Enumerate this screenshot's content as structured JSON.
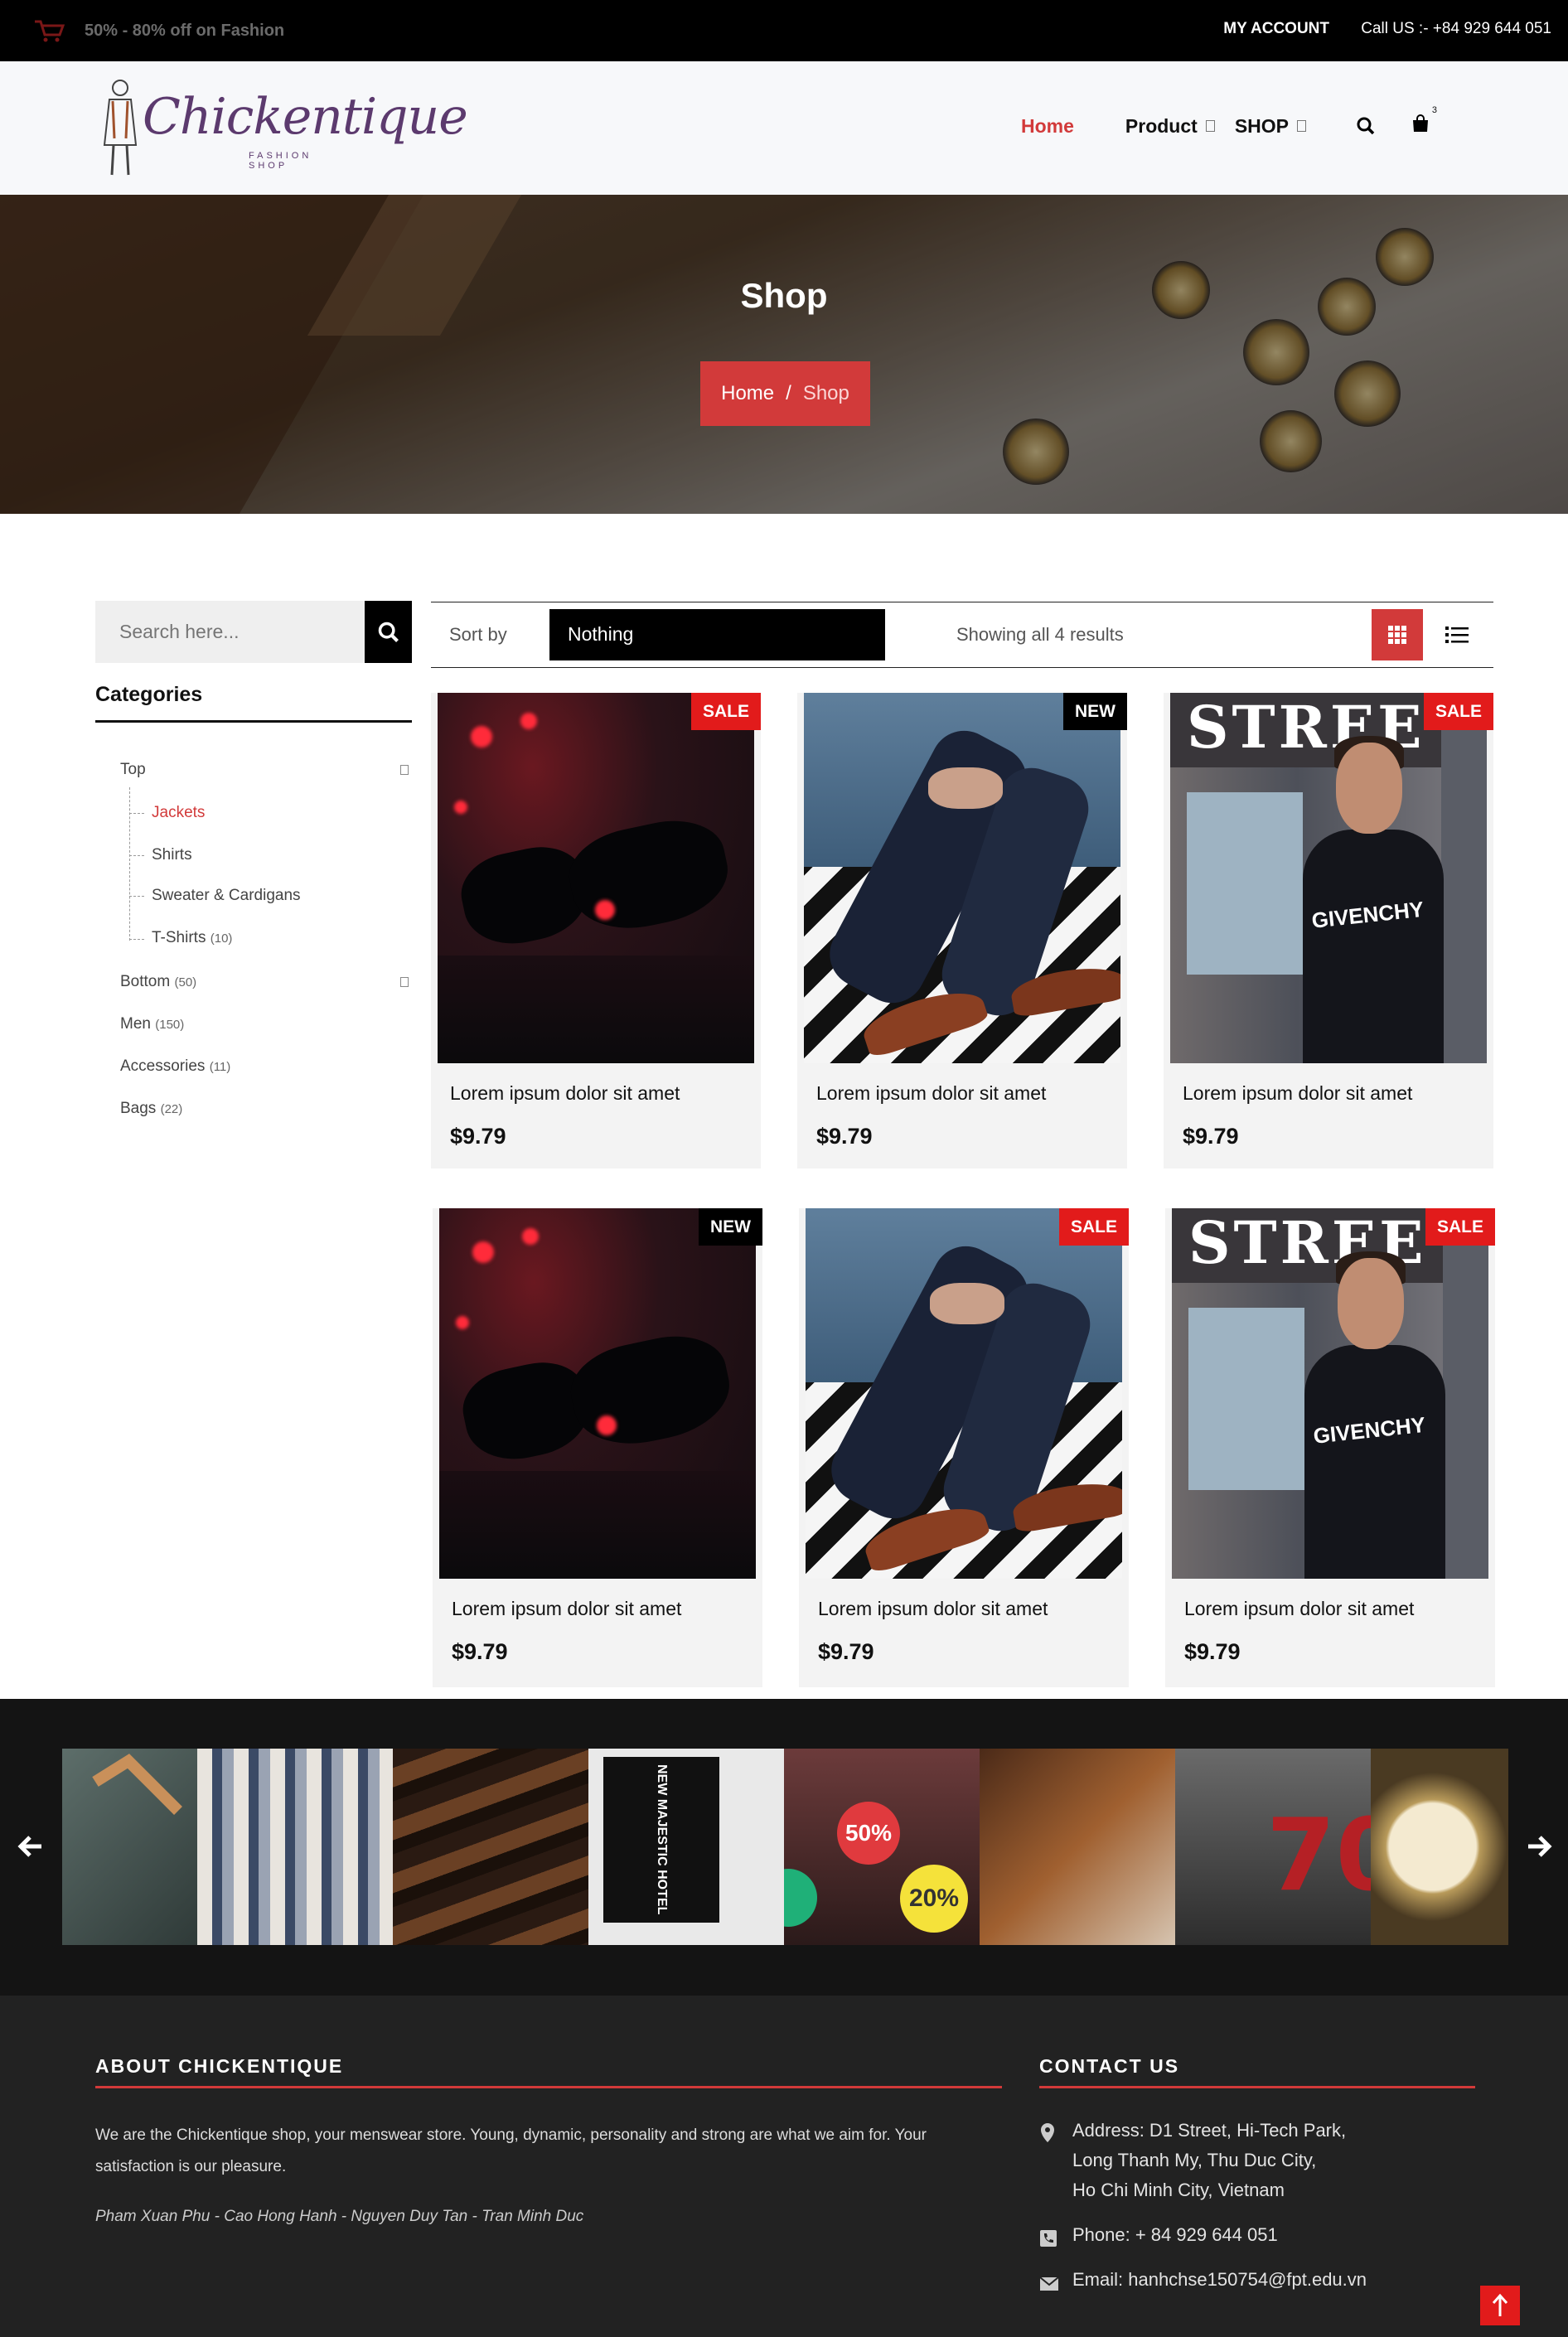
{
  "topbar": {
    "promo": "50% - 80% off on Fashion",
    "account": "MY ACCOUNT",
    "phone": "Call US :- +84 929 644 051"
  },
  "brand": {
    "name": "Chickentique",
    "tagline": "FASHION SHOP"
  },
  "nav": {
    "home": "Home",
    "product": "Product",
    "shop": "SHOP",
    "cart_count": "3",
    "active_color": "#d23a3a"
  },
  "hero": {
    "title": "Shop",
    "crumb_home": "Home",
    "crumb_sep": "/",
    "crumb_current": "Shop"
  },
  "sidebar": {
    "search_placeholder": "Search here...",
    "categories_title": "Categories",
    "top": "Top",
    "jackets": "Jackets",
    "shirts": "Shirts",
    "sweater": "Sweater & Cardigans",
    "tshirts": "T-Shirts",
    "tshirts_count": "(10)",
    "bottom": "Bottom",
    "bottom_count": "(50)",
    "men": "Men",
    "men_count": "(150)",
    "accessories": "Accessories",
    "accessories_count": "(11)",
    "bags": "Bags",
    "bags_count": "(22)"
  },
  "toolbar": {
    "sort_label": "Sort by",
    "sort_value": "Nothing",
    "showing": "Showing all 4 results"
  },
  "products": [
    {
      "name": "Lorem ipsum dolor sit amet",
      "price": "$9.79",
      "badge": "SALE",
      "image": "sunglasses"
    },
    {
      "name": "Lorem ipsum dolor sit amet",
      "price": "$9.79",
      "badge": "NEW",
      "image": "legs-shoes"
    },
    {
      "name": "Lorem ipsum dolor sit amet",
      "price": "$9.79",
      "badge": "SALE",
      "image": "man-street"
    },
    {
      "name": "Lorem ipsum dolor sit amet",
      "price": "$9.79",
      "badge": "NEW",
      "image": "sunglasses"
    },
    {
      "name": "Lorem ipsum dolor sit amet",
      "price": "$9.79",
      "badge": "SALE",
      "image": "legs-shoes"
    },
    {
      "name": "Lorem ipsum dolor sit amet",
      "price": "$9.79",
      "badge": "SALE",
      "image": "man-street"
    }
  ],
  "product_image_text": {
    "street_sign": "STREE",
    "shirt_logo": "GIVENCHY"
  },
  "gallery": {
    "bag_text": "NEW MAJESTIC HOTEL",
    "sale50": "50%",
    "sale20": "20%",
    "sale70": "70"
  },
  "footer": {
    "about_title": "ABOUT CHICKENTIQUE",
    "about_text": "We are the Chickentique shop, your menswear store. Young, dynamic, personality and strong are what we aim for. Your satisfaction is our pleasure.",
    "authors": "Pham Xuan Phu - Cao Hong Hanh - Nguyen Duy Tan - Tran Minh Duc",
    "contact_title": "CONTACT US",
    "address_line1": "Address: D1 Street, Hi-Tech Park,",
    "address_line2": "Long Thanh My, Thu Duc City,",
    "address_line3": "Ho Chi Minh City, Vietnam",
    "phone": "Phone: + 84 929 644 051",
    "email": "Email: hanhchse150754@fpt.edu.vn"
  }
}
